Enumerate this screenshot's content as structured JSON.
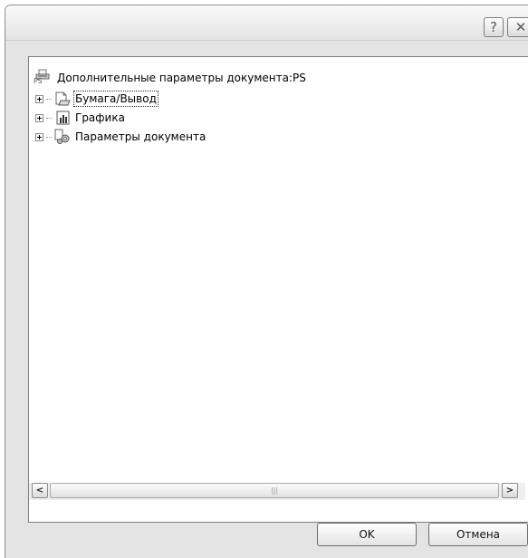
{
  "titlebar": {
    "help_label": "?",
    "close_label": "✕"
  },
  "tree": {
    "root": {
      "label": "Дополнительные параметры документа:PS",
      "icon": "printer-document-icon",
      "badge": "PS"
    },
    "items": [
      {
        "label": "Бумага/Вывод",
        "icon": "paper-output-icon",
        "focused": true
      },
      {
        "label": "Графика",
        "icon": "graphics-chart-icon",
        "focused": false
      },
      {
        "label": "Параметры документа",
        "icon": "document-settings-gears-icon",
        "focused": false
      }
    ]
  },
  "scrollbar": {
    "left_arrow": "<",
    "right_arrow": ">",
    "thumb_grip": "|||"
  },
  "buttons": {
    "ok_label": "OK",
    "cancel_label": "Отмена"
  }
}
